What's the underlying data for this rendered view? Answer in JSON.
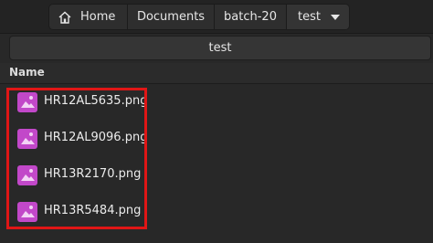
{
  "breadcrumbs": {
    "home": "Home",
    "documents": "Documents",
    "batch": "batch-20",
    "current": "test"
  },
  "title": "test",
  "column_header": {
    "name": "Name"
  },
  "files": [
    {
      "name": "HR12AL5635.png"
    },
    {
      "name": "HR12AL9096.png"
    },
    {
      "name": "HR13R2170.png"
    },
    {
      "name": "HR13R5484.png"
    }
  ],
  "colors": {
    "file_icon": "#c248c9",
    "highlight": "#e01616"
  },
  "icons": {
    "home": "home-icon",
    "dropdown": "caret-down-icon",
    "image_file": "image-file-icon"
  }
}
